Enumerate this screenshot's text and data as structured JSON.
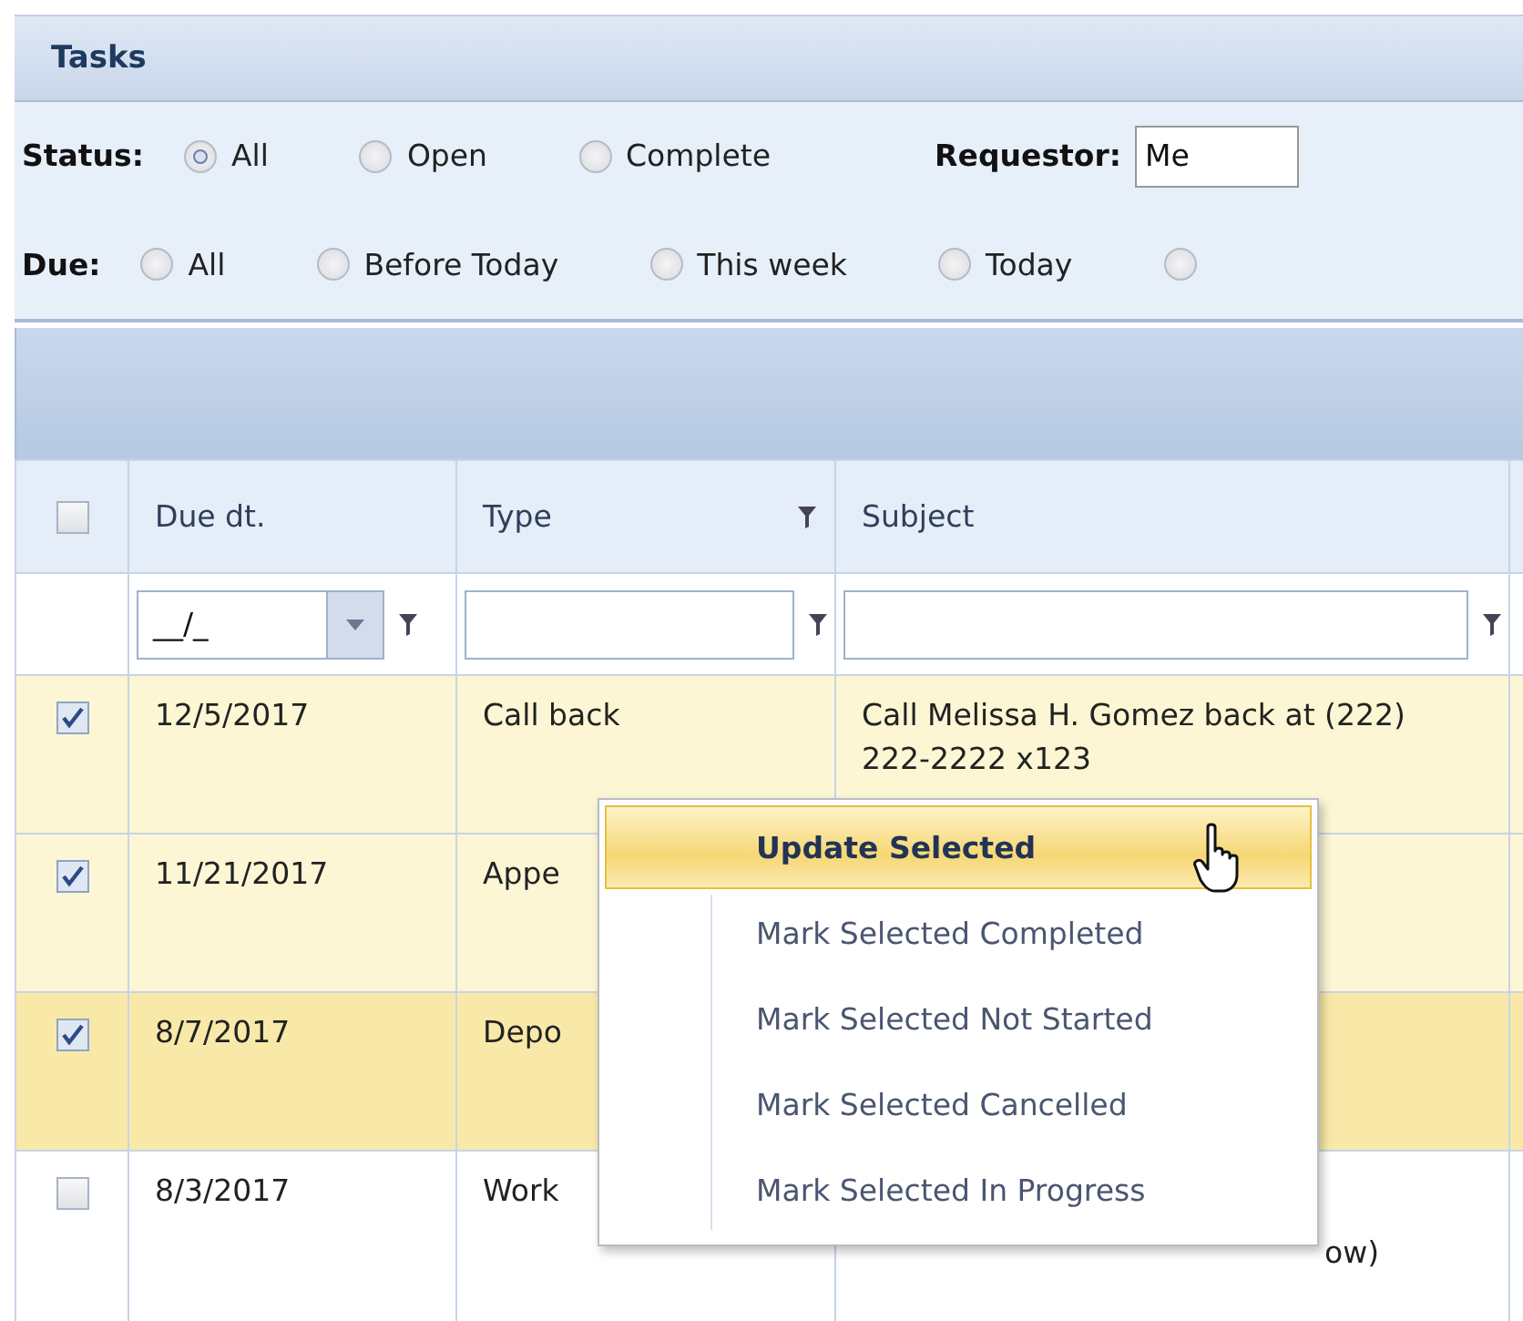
{
  "panel": {
    "title": "Tasks"
  },
  "filters": {
    "status": {
      "label": "Status:",
      "options": [
        {
          "label": "All",
          "selected": true
        },
        {
          "label": "Open",
          "selected": false
        },
        {
          "label": "Complete",
          "selected": false
        }
      ]
    },
    "requestor": {
      "label": "Requestor:",
      "value": "Me"
    },
    "due": {
      "label": "Due:",
      "options": [
        {
          "label": "All",
          "selected": false
        },
        {
          "label": "Before Today",
          "selected": false
        },
        {
          "label": "This week",
          "selected": false
        },
        {
          "label": "Today",
          "selected": false
        },
        {
          "selected": false
        }
      ]
    }
  },
  "table": {
    "select_all": {
      "checked": false
    },
    "columns": [
      {
        "label": "Due dt.",
        "filter_icon": false
      },
      {
        "label": "Type",
        "filter_icon": true
      },
      {
        "label": "Subject",
        "filter_icon": false
      }
    ],
    "filter_row": {
      "date_placeholder": "__/_"
    },
    "rows": [
      {
        "checked": true,
        "selected": false,
        "due": "12/5/2017",
        "type": "Call back",
        "subject": "Call Melissa H. Gomez back at (222) 222-2222 x123"
      },
      {
        "checked": true,
        "selected": false,
        "due": "11/21/2017",
        "type": "Appe",
        "subject": ""
      },
      {
        "checked": true,
        "selected": true,
        "due": "8/7/2017",
        "type": "Depo",
        "subject": ""
      },
      {
        "checked": false,
        "selected": false,
        "due": "8/3/2017",
        "type": "Work",
        "subject_tail": "ow)"
      }
    ]
  },
  "context_menu": {
    "items": [
      {
        "label": "Update Selected",
        "selected": true,
        "kind": "primary"
      },
      {
        "label": "Mark Selected Completed",
        "selected": false,
        "kind": "normal"
      },
      {
        "label": "Mark Selected Not Started",
        "selected": false,
        "kind": "normal"
      },
      {
        "label": "Mark Selected Cancelled",
        "selected": false,
        "kind": "normal"
      },
      {
        "label": "Mark Selected In Progress",
        "selected": false,
        "kind": "normal"
      }
    ]
  }
}
